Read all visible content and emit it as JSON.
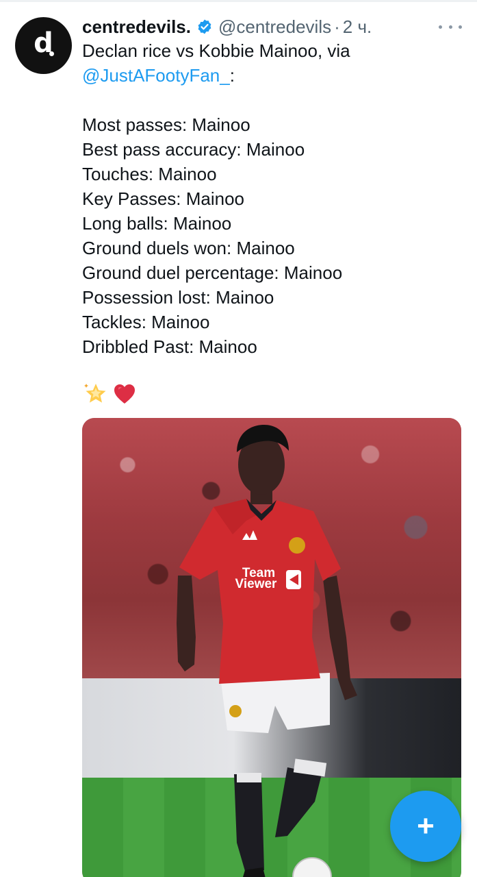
{
  "post": {
    "display_name": "centredevils.",
    "handle": "@centredevils",
    "separator": "·",
    "time": "2 ч.",
    "avatar_letter": "d",
    "text_line1": "Declan rice vs Kobbie Mainoo, via",
    "mention": "@JustAFootyFan_",
    "mention_suffix": ":",
    "stats": [
      "Most passes: Mainoo",
      "Best pass accuracy: Mainoo",
      "Touches: Mainoo",
      "Key Passes: Mainoo",
      "Long balls: Mainoo",
      "Ground duels won: Mainoo",
      "Ground duel percentage: Mainoo",
      "Possession lost: Mainoo",
      "Tackles: Mainoo",
      "Dribbled Past: Mainoo"
    ],
    "emojis": [
      "glowing-star-icon",
      "red-heart-icon"
    ],
    "media": {
      "shirt_sponsor_line1": "Team",
      "shirt_sponsor_line2": "Viewer"
    }
  },
  "icons": {
    "verified": "verified-badge-icon",
    "more": "more-options-icon",
    "compose": "plus-icon"
  },
  "compose_label": "+",
  "colors": {
    "accent": "#1d9bf0",
    "text": "#0f1419",
    "secondary": "#536471"
  }
}
